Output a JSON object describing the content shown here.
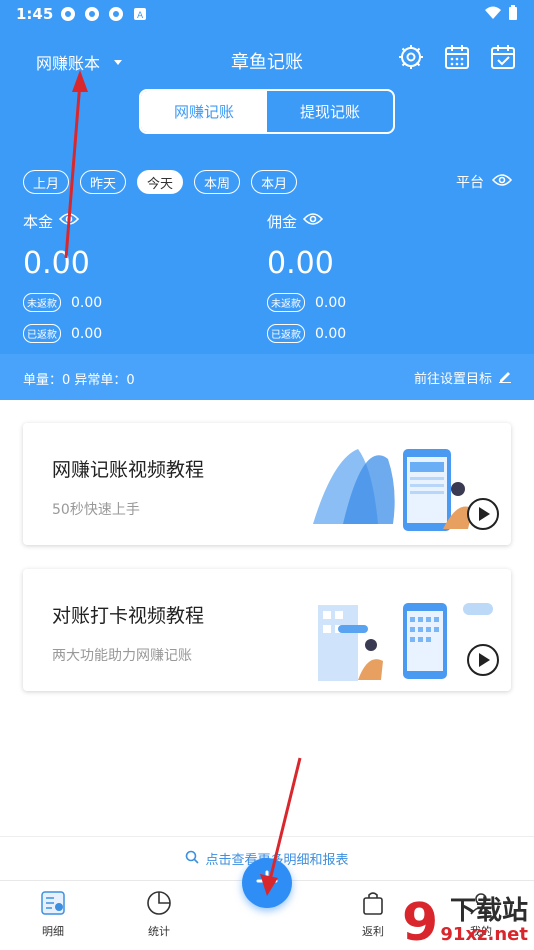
{
  "status": {
    "time": "1:45",
    "icons": [
      "app-icon",
      "app-icon",
      "app-icon",
      "a-icon"
    ],
    "right_icons": [
      "wifi-icon",
      "battery-icon"
    ]
  },
  "header": {
    "book_label": "网赚账本",
    "title": "章鱼记账",
    "icons": [
      "gear-icon",
      "calendar-icon",
      "calendar-check-icon"
    ]
  },
  "segment": {
    "tabs": [
      {
        "label": "网赚记账",
        "active": true
      },
      {
        "label": "提现记账",
        "active": false
      }
    ]
  },
  "chips": [
    {
      "label": "上月"
    },
    {
      "label": "昨天"
    },
    {
      "label": "今天",
      "active": true
    },
    {
      "label": "本周"
    },
    {
      "label": "本月"
    }
  ],
  "platform_label": "平台",
  "principal": {
    "label": "本金",
    "value": "0.00",
    "unreturned_tag": "未返款",
    "unreturned": "0.00",
    "returned_tag": "已返款",
    "returned": "0.00"
  },
  "commission": {
    "label": "佣金",
    "value": "0.00",
    "unreturned_tag": "未返款",
    "unreturned": "0.00",
    "returned_tag": "已返款",
    "returned": "0.00"
  },
  "strip": {
    "left": "单量：0 异常单：0",
    "right": "前往设置目标"
  },
  "cards": [
    {
      "title": "网赚记账视频教程",
      "subtitle": "50秒快速上手"
    },
    {
      "title": "对账打卡视频教程",
      "subtitle": "两大功能助力网赚记账"
    }
  ],
  "bottom_link": "点击查看更多明细和报表",
  "tabs": [
    {
      "label": "明细",
      "icon": "list-icon"
    },
    {
      "label": "统计",
      "icon": "pie-chart-icon"
    },
    {
      "label": "返利",
      "icon": "shopping-bag-icon"
    },
    {
      "label": "我的",
      "icon": "user-icon"
    }
  ],
  "watermark": {
    "text": "下载站",
    "url": "91xz.net"
  }
}
